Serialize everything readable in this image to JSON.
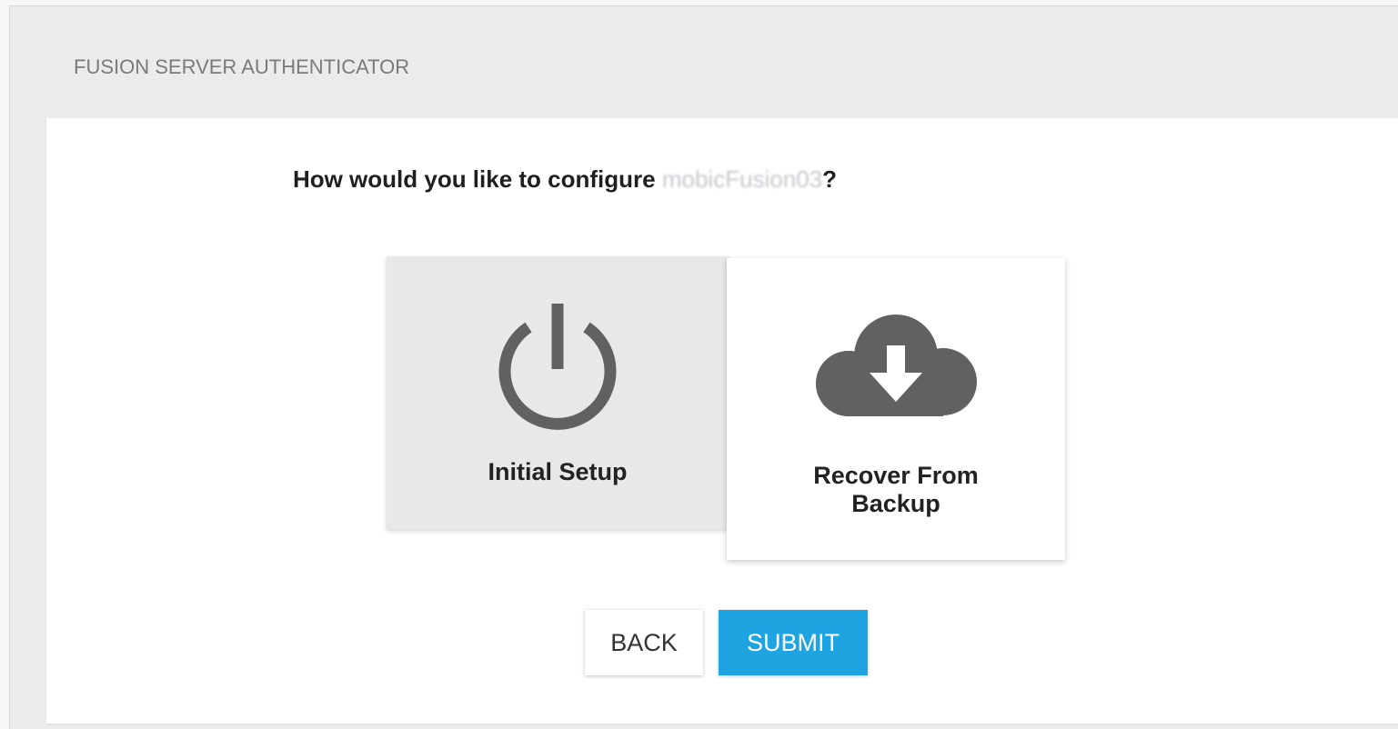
{
  "app": {
    "title": "FUSION SERVER AUTHENTICATOR"
  },
  "prompt": {
    "prefix": "How would you like to configure ",
    "hostname": "mobicFusion03",
    "suffix": "?"
  },
  "options": [
    {
      "label": "Initial Setup",
      "icon": "power-icon",
      "selected": true
    },
    {
      "label": "Recover From Backup",
      "icon": "cloud-download-icon",
      "selected": false
    }
  ],
  "actions": {
    "back_label": "BACK",
    "submit_label": "SUBMIT"
  },
  "colors": {
    "accent": "#1ea4e0",
    "icon": "#616161",
    "selected_card": "#e8e8e8"
  }
}
